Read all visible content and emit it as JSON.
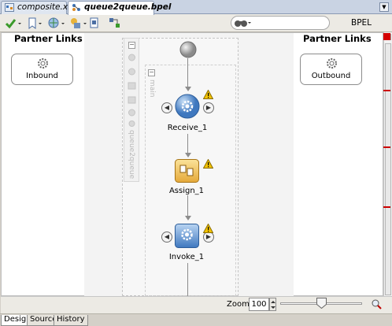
{
  "tabs": [
    {
      "label": "composite.xml"
    },
    {
      "label": "queue2queue.bpel"
    }
  ],
  "toolbar": {
    "bpel_label": "BPEL"
  },
  "search": {
    "placeholder": ""
  },
  "left_lane": {
    "title": "Partner Links",
    "link": "Inbound"
  },
  "right_lane": {
    "title": "Partner Links",
    "link": "Outbound"
  },
  "process": {
    "scope_label": "queue2queue",
    "sequence_label": "main"
  },
  "activities": [
    {
      "label": "Receive_1"
    },
    {
      "label": "Assign_1"
    },
    {
      "label": "Invoke_1"
    }
  ],
  "zoom": {
    "label": "Zoom:",
    "value": "100"
  },
  "bottom_tabs": [
    {
      "label": "Design"
    },
    {
      "label": "Source"
    },
    {
      "label": "History"
    }
  ],
  "colors": {
    "canvas_bg": "#ffffff",
    "warning": "#f2c200",
    "error_marker": "#cc0000",
    "receive_blue": "#4f86c6",
    "assign_yellow": "#f3c75a"
  }
}
